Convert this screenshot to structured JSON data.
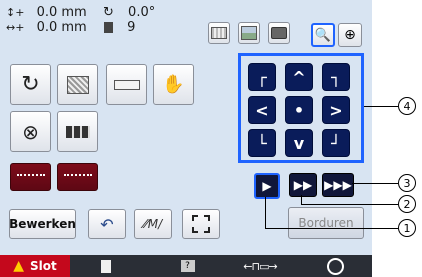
{
  "status": {
    "horizontal": "0.0 mm",
    "vertical": "0.0 mm",
    "angle": "0.0°",
    "color_count": "9"
  },
  "buttons": {
    "edit_label": "Bewerken",
    "embroider_label": "Borduren"
  },
  "tabs": {
    "slot_label": "Slot"
  },
  "icons": {
    "status_move_h": "move-horizontal-icon",
    "status_move_v": "move-vertical-icon",
    "status_angle": "rotate-angle-icon",
    "status_colors": "thread-spool-icon"
  },
  "colors": {
    "screen_bg": "#d8e4f2",
    "nav_button": "#0a1c5a",
    "highlight_frame": "#1f63ff",
    "tab_bar": "#2a2e36",
    "warning": "#ffcc00"
  },
  "callouts": [
    "1",
    "2",
    "3",
    "4"
  ]
}
